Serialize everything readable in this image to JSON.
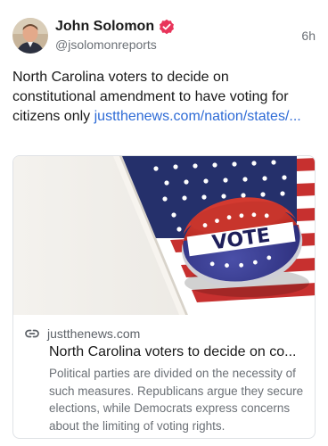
{
  "post": {
    "author_name": "John Solomon",
    "handle": "@jsolomonreports",
    "timestamp": "6h",
    "verified_color": "#e8345a",
    "text": "North Carolina voters to decide on constitutional amendment to have voting for citizens only",
    "link_text": "justthenews.com/nation/states/..."
  },
  "card": {
    "image_label": "VOTE",
    "domain": "justthenews.com",
    "title": "North Carolina voters to decide on co...",
    "description": "Political parties are divided on the necessity of such measures. Republicans argue they secure elections, while Democrats express concerns about the limiting of voting rights."
  },
  "icons": {
    "verified": "verified-badge-icon",
    "link": "link-icon"
  }
}
